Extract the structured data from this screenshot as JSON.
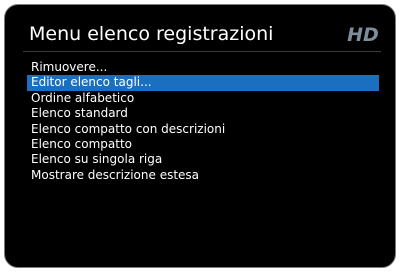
{
  "title": "Menu elenco registrazioni",
  "logo": {
    "icon": "hd-logo-icon",
    "text": "HD",
    "color": "#7f8c99"
  },
  "accent_color": "#1a6fc0",
  "selected_index": 1,
  "menu": {
    "items": [
      {
        "label": "Rimuovere..."
      },
      {
        "label": "Editor elenco tagli..."
      },
      {
        "label": "Ordine alfabetico"
      },
      {
        "label": "Elenco standard"
      },
      {
        "label": "Elenco compatto con descrizioni"
      },
      {
        "label": "Elenco compatto"
      },
      {
        "label": "Elenco su singola riga"
      },
      {
        "label": "Mostrare descrizione estesa"
      }
    ]
  }
}
